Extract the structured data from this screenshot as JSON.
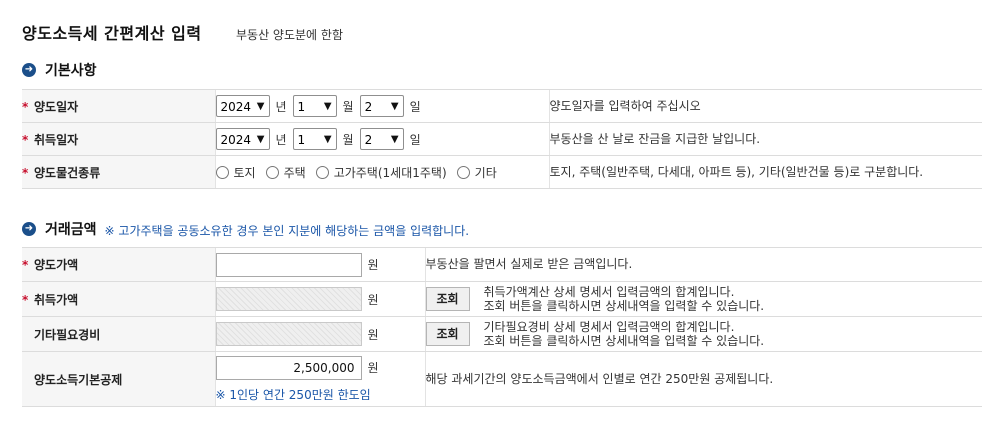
{
  "page": {
    "title": "양도소득세 간편계산 입력",
    "subtitle": "부동산 양도분에 한함"
  },
  "section1": {
    "icon": "circle-arrow-right-icon",
    "title": "기본사항",
    "rows": {
      "transfer_date": {
        "label": "양도일자",
        "year": "2024",
        "month": "1",
        "day": "2",
        "desc": "양도일자를 입력하여 주십시오"
      },
      "acquire_date": {
        "label": "취득일자",
        "year": "2024",
        "month": "1",
        "day": "2",
        "desc": "부동산을 산 날로 잔금을 지급한 날입니다."
      },
      "property_type": {
        "label": "양도물건종류",
        "options": [
          "토지",
          "주택",
          "고가주택(1세대1주택)",
          "기타"
        ],
        "desc": "토지, 주택(일반주택, 다세대, 아파트 등), 기타(일반건물 등)로 구분합니다."
      }
    },
    "units": {
      "year": "년",
      "month": "월",
      "day": "일"
    }
  },
  "section2": {
    "icon": "circle-arrow-right-icon",
    "title": "거래금액",
    "note": "※ 고가주택을 공동소유한 경우 본인 지분에 해당하는 금액을 입력합니다.",
    "won": "원",
    "lookup_label": "조회",
    "rows": {
      "sale_price": {
        "label": "양도가액",
        "value": "",
        "desc": "부동산을 팔면서 실제로 받은 금액입니다."
      },
      "acq_price": {
        "label": "취득가액",
        "value": "",
        "desc1": "취득가액계산 상세 명세서 입력금액의 합계입니다.",
        "desc2": "조회 버튼을 클릭하시면 상세내역을 입력할 수 있습니다."
      },
      "other_exp": {
        "label": "기타필요경비",
        "value": "",
        "desc1": "기타필요경비 상세 명세서 입력금액의 합계입니다.",
        "desc2": "조회 버튼을 클릭하시면 상세내역을 입력할 수 있습니다."
      },
      "basic_deduction": {
        "label": "양도소득기본공제",
        "value": "2,500,000",
        "note": "※ 1인당 연간 250만원 한도임",
        "desc": "해당 과세기간의 양도소득금액에서 인별로 연간 250만원 공제됩니다."
      }
    }
  },
  "colors": {
    "accent": "#1b4f8a",
    "required": "#c8102e",
    "note": "#1a56a8"
  }
}
